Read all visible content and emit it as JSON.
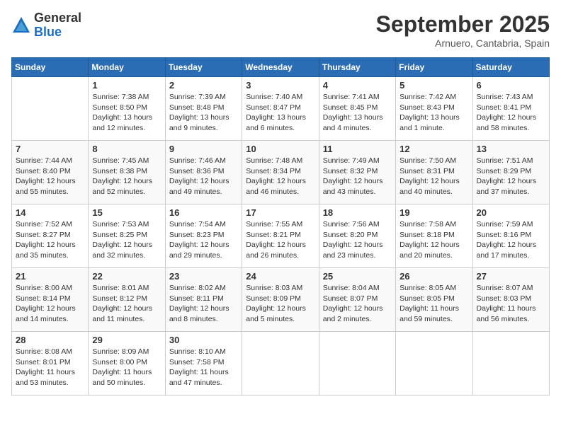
{
  "logo": {
    "general": "General",
    "blue": "Blue"
  },
  "title": "September 2025",
  "location": "Arnuero, Cantabria, Spain",
  "weekdays": [
    "Sunday",
    "Monday",
    "Tuesday",
    "Wednesday",
    "Thursday",
    "Friday",
    "Saturday"
  ],
  "weeks": [
    [
      {
        "day": "",
        "sunrise": "",
        "sunset": "",
        "daylight": ""
      },
      {
        "day": "1",
        "sunrise": "Sunrise: 7:38 AM",
        "sunset": "Sunset: 8:50 PM",
        "daylight": "Daylight: 13 hours and 12 minutes."
      },
      {
        "day": "2",
        "sunrise": "Sunrise: 7:39 AM",
        "sunset": "Sunset: 8:48 PM",
        "daylight": "Daylight: 13 hours and 9 minutes."
      },
      {
        "day": "3",
        "sunrise": "Sunrise: 7:40 AM",
        "sunset": "Sunset: 8:47 PM",
        "daylight": "Daylight: 13 hours and 6 minutes."
      },
      {
        "day": "4",
        "sunrise": "Sunrise: 7:41 AM",
        "sunset": "Sunset: 8:45 PM",
        "daylight": "Daylight: 13 hours and 4 minutes."
      },
      {
        "day": "5",
        "sunrise": "Sunrise: 7:42 AM",
        "sunset": "Sunset: 8:43 PM",
        "daylight": "Daylight: 13 hours and 1 minute."
      },
      {
        "day": "6",
        "sunrise": "Sunrise: 7:43 AM",
        "sunset": "Sunset: 8:41 PM",
        "daylight": "Daylight: 12 hours and 58 minutes."
      }
    ],
    [
      {
        "day": "7",
        "sunrise": "Sunrise: 7:44 AM",
        "sunset": "Sunset: 8:40 PM",
        "daylight": "Daylight: 12 hours and 55 minutes."
      },
      {
        "day": "8",
        "sunrise": "Sunrise: 7:45 AM",
        "sunset": "Sunset: 8:38 PM",
        "daylight": "Daylight: 12 hours and 52 minutes."
      },
      {
        "day": "9",
        "sunrise": "Sunrise: 7:46 AM",
        "sunset": "Sunset: 8:36 PM",
        "daylight": "Daylight: 12 hours and 49 minutes."
      },
      {
        "day": "10",
        "sunrise": "Sunrise: 7:48 AM",
        "sunset": "Sunset: 8:34 PM",
        "daylight": "Daylight: 12 hours and 46 minutes."
      },
      {
        "day": "11",
        "sunrise": "Sunrise: 7:49 AM",
        "sunset": "Sunset: 8:32 PM",
        "daylight": "Daylight: 12 hours and 43 minutes."
      },
      {
        "day": "12",
        "sunrise": "Sunrise: 7:50 AM",
        "sunset": "Sunset: 8:31 PM",
        "daylight": "Daylight: 12 hours and 40 minutes."
      },
      {
        "day": "13",
        "sunrise": "Sunrise: 7:51 AM",
        "sunset": "Sunset: 8:29 PM",
        "daylight": "Daylight: 12 hours and 37 minutes."
      }
    ],
    [
      {
        "day": "14",
        "sunrise": "Sunrise: 7:52 AM",
        "sunset": "Sunset: 8:27 PM",
        "daylight": "Daylight: 12 hours and 35 minutes."
      },
      {
        "day": "15",
        "sunrise": "Sunrise: 7:53 AM",
        "sunset": "Sunset: 8:25 PM",
        "daylight": "Daylight: 12 hours and 32 minutes."
      },
      {
        "day": "16",
        "sunrise": "Sunrise: 7:54 AM",
        "sunset": "Sunset: 8:23 PM",
        "daylight": "Daylight: 12 hours and 29 minutes."
      },
      {
        "day": "17",
        "sunrise": "Sunrise: 7:55 AM",
        "sunset": "Sunset: 8:21 PM",
        "daylight": "Daylight: 12 hours and 26 minutes."
      },
      {
        "day": "18",
        "sunrise": "Sunrise: 7:56 AM",
        "sunset": "Sunset: 8:20 PM",
        "daylight": "Daylight: 12 hours and 23 minutes."
      },
      {
        "day": "19",
        "sunrise": "Sunrise: 7:58 AM",
        "sunset": "Sunset: 8:18 PM",
        "daylight": "Daylight: 12 hours and 20 minutes."
      },
      {
        "day": "20",
        "sunrise": "Sunrise: 7:59 AM",
        "sunset": "Sunset: 8:16 PM",
        "daylight": "Daylight: 12 hours and 17 minutes."
      }
    ],
    [
      {
        "day": "21",
        "sunrise": "Sunrise: 8:00 AM",
        "sunset": "Sunset: 8:14 PM",
        "daylight": "Daylight: 12 hours and 14 minutes."
      },
      {
        "day": "22",
        "sunrise": "Sunrise: 8:01 AM",
        "sunset": "Sunset: 8:12 PM",
        "daylight": "Daylight: 12 hours and 11 minutes."
      },
      {
        "day": "23",
        "sunrise": "Sunrise: 8:02 AM",
        "sunset": "Sunset: 8:11 PM",
        "daylight": "Daylight: 12 hours and 8 minutes."
      },
      {
        "day": "24",
        "sunrise": "Sunrise: 8:03 AM",
        "sunset": "Sunset: 8:09 PM",
        "daylight": "Daylight: 12 hours and 5 minutes."
      },
      {
        "day": "25",
        "sunrise": "Sunrise: 8:04 AM",
        "sunset": "Sunset: 8:07 PM",
        "daylight": "Daylight: 12 hours and 2 minutes."
      },
      {
        "day": "26",
        "sunrise": "Sunrise: 8:05 AM",
        "sunset": "Sunset: 8:05 PM",
        "daylight": "Daylight: 11 hours and 59 minutes."
      },
      {
        "day": "27",
        "sunrise": "Sunrise: 8:07 AM",
        "sunset": "Sunset: 8:03 PM",
        "daylight": "Daylight: 11 hours and 56 minutes."
      }
    ],
    [
      {
        "day": "28",
        "sunrise": "Sunrise: 8:08 AM",
        "sunset": "Sunset: 8:01 PM",
        "daylight": "Daylight: 11 hours and 53 minutes."
      },
      {
        "day": "29",
        "sunrise": "Sunrise: 8:09 AM",
        "sunset": "Sunset: 8:00 PM",
        "daylight": "Daylight: 11 hours and 50 minutes."
      },
      {
        "day": "30",
        "sunrise": "Sunrise: 8:10 AM",
        "sunset": "Sunset: 7:58 PM",
        "daylight": "Daylight: 11 hours and 47 minutes."
      },
      {
        "day": "",
        "sunrise": "",
        "sunset": "",
        "daylight": ""
      },
      {
        "day": "",
        "sunrise": "",
        "sunset": "",
        "daylight": ""
      },
      {
        "day": "",
        "sunrise": "",
        "sunset": "",
        "daylight": ""
      },
      {
        "day": "",
        "sunrise": "",
        "sunset": "",
        "daylight": ""
      }
    ]
  ]
}
